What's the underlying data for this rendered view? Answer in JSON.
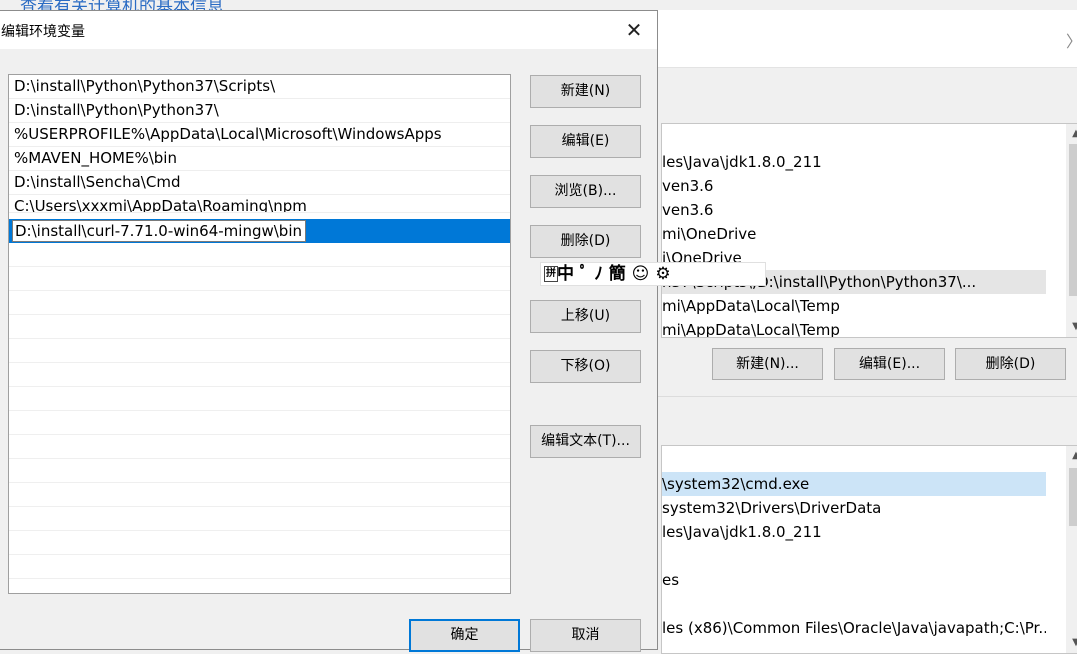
{
  "background": {
    "top_link": "查看有关计算机的基本信息",
    "close_glyph": "〉",
    "user_vars": {
      "rows": [
        "les\\Java\\jdk1.8.0_211",
        "ven3.6",
        "ven3.6",
        "mi\\OneDrive",
        "i\\OneDrive",
        "n37\\Scripts\\;D:\\install\\Python\\Python37\\...",
        "mi\\AppData\\Local\\Temp",
        "mi\\AppData\\Local\\Temp"
      ],
      "buttons": {
        "new": "新建(N)...",
        "edit": "编辑(E)...",
        "delete": "删除(D)"
      }
    },
    "system_vars": {
      "rows": [
        "\\system32\\cmd.exe",
        "system32\\Drivers\\DriverData",
        "les\\Java\\jdk1.8.0_211",
        "",
        "es",
        "",
        "les (x86)\\Common Files\\Oracle\\Java\\javapath;C:\\Pr..."
      ]
    }
  },
  "ime_bar": {
    "icon": "拼",
    "text": "中 ﾟ ﾉ 簡 ☺ ⚙"
  },
  "dialog": {
    "title": "编辑环境变量",
    "close_glyph": "✕",
    "paths": [
      "D:\\install\\Python\\Python37\\Scripts\\",
      "D:\\install\\Python\\Python37\\",
      "%USERPROFILE%\\AppData\\Local\\Microsoft\\WindowsApps",
      "%MAVEN_HOME%\\bin",
      "D:\\install\\Sencha\\Cmd",
      "C:\\Users\\xxxmi\\AppData\\Roaming\\npm"
    ],
    "editing_value": "D:\\install\\curl-7.71.0-win64-mingw\\bin",
    "buttons": {
      "new": "新建(N)",
      "edit": "编辑(E)",
      "browse": "浏览(B)...",
      "delete": "删除(D)",
      "move_up": "上移(U)",
      "move_down": "下移(O)",
      "edit_text": "编辑文本(T)...",
      "ok": "确定",
      "cancel": "取消"
    }
  },
  "colors": {
    "selection": "#0078d7",
    "button_face": "#e1e1e1",
    "link": "#2b6cc4"
  }
}
